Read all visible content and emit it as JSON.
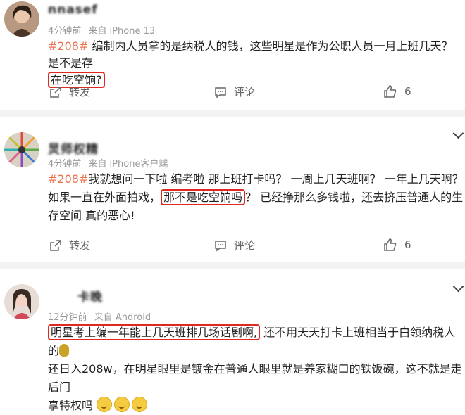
{
  "posts": [
    {
      "username": "nnasef",
      "time": "4分钟前",
      "source": "来自 iPhone 13",
      "tag": "#208#",
      "text_a": " 编制内人员拿的是纳税人的钱，这些明星是作为公职人员一月上班几天？是不是存",
      "highlight": "在吃空饷?",
      "text_b": "",
      "forward_label": "转发",
      "comment_label": "评论",
      "like_count": "6"
    },
    {
      "username": "炅师权精",
      "time": "4分钟前",
      "source": "来自 iPhone客户端",
      "tag": "#208#",
      "text_a": "我就想问一下啦 编考啦 那上班打卡吗？ 一周上几天班啊？ 一年上几天啊？ 如果一直在外面拍戏，",
      "highlight": "那不是吃空饷吗",
      "text_b": "？ 已经挣那么多钱啦，还去挤压普通人的生存空间 真的恶心!",
      "forward_label": "转发",
      "comment_label": "评论",
      "like_count": "6"
    },
    {
      "username": "卡晚",
      "time": "12分钟前",
      "source": "来自 Android",
      "highlight": "明星考上编一年能上几天班排几场话剧啊,",
      "text_b": " 还不用天天打卡上班相当于白领纳税人的",
      "line2": "还日入208w，在明星眼里是镀金在普通人眼里就是养家糊口的铁饭碗，这不就是走后门",
      "line3": "享特权吗"
    }
  ],
  "colors": {
    "tag": "#eb7350",
    "highlight_border": "#e0281e",
    "meta": "#999999"
  },
  "icons": [
    "forward-icon",
    "comment-icon",
    "like-icon",
    "chevron-down-icon",
    "smile-emoji",
    "money-bag-emoji"
  ]
}
